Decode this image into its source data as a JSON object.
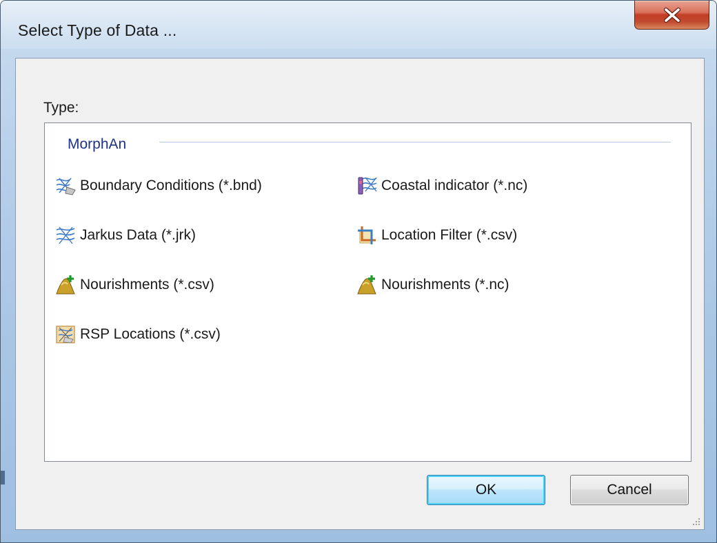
{
  "window": {
    "title": "Select Type of Data ..."
  },
  "dialog": {
    "type_label": "Type:",
    "group": {
      "title": "MorphAn"
    },
    "items": [
      {
        "label": "Boundary Conditions (*.bnd)",
        "icon": "boundary-conditions-icon"
      },
      {
        "label": "Coastal indicator (*.nc)",
        "icon": "coastal-indicator-icon"
      },
      {
        "label": "Jarkus Data (*.jrk)",
        "icon": "jarkus-data-icon"
      },
      {
        "label": "Location Filter (*.csv)",
        "icon": "location-filter-icon"
      },
      {
        "label": "Nourishments (*.csv)",
        "icon": "nourishments-icon"
      },
      {
        "label": "Nourishments (*.nc)",
        "icon": "nourishments-icon"
      },
      {
        "label": "RSP Locations (*.csv)",
        "icon": "rsp-locations-icon"
      }
    ]
  },
  "buttons": {
    "ok_label": "OK",
    "cancel_label": "Cancel"
  },
  "colors": {
    "group_title": "#1e3287",
    "close_button": "#c23d24"
  }
}
